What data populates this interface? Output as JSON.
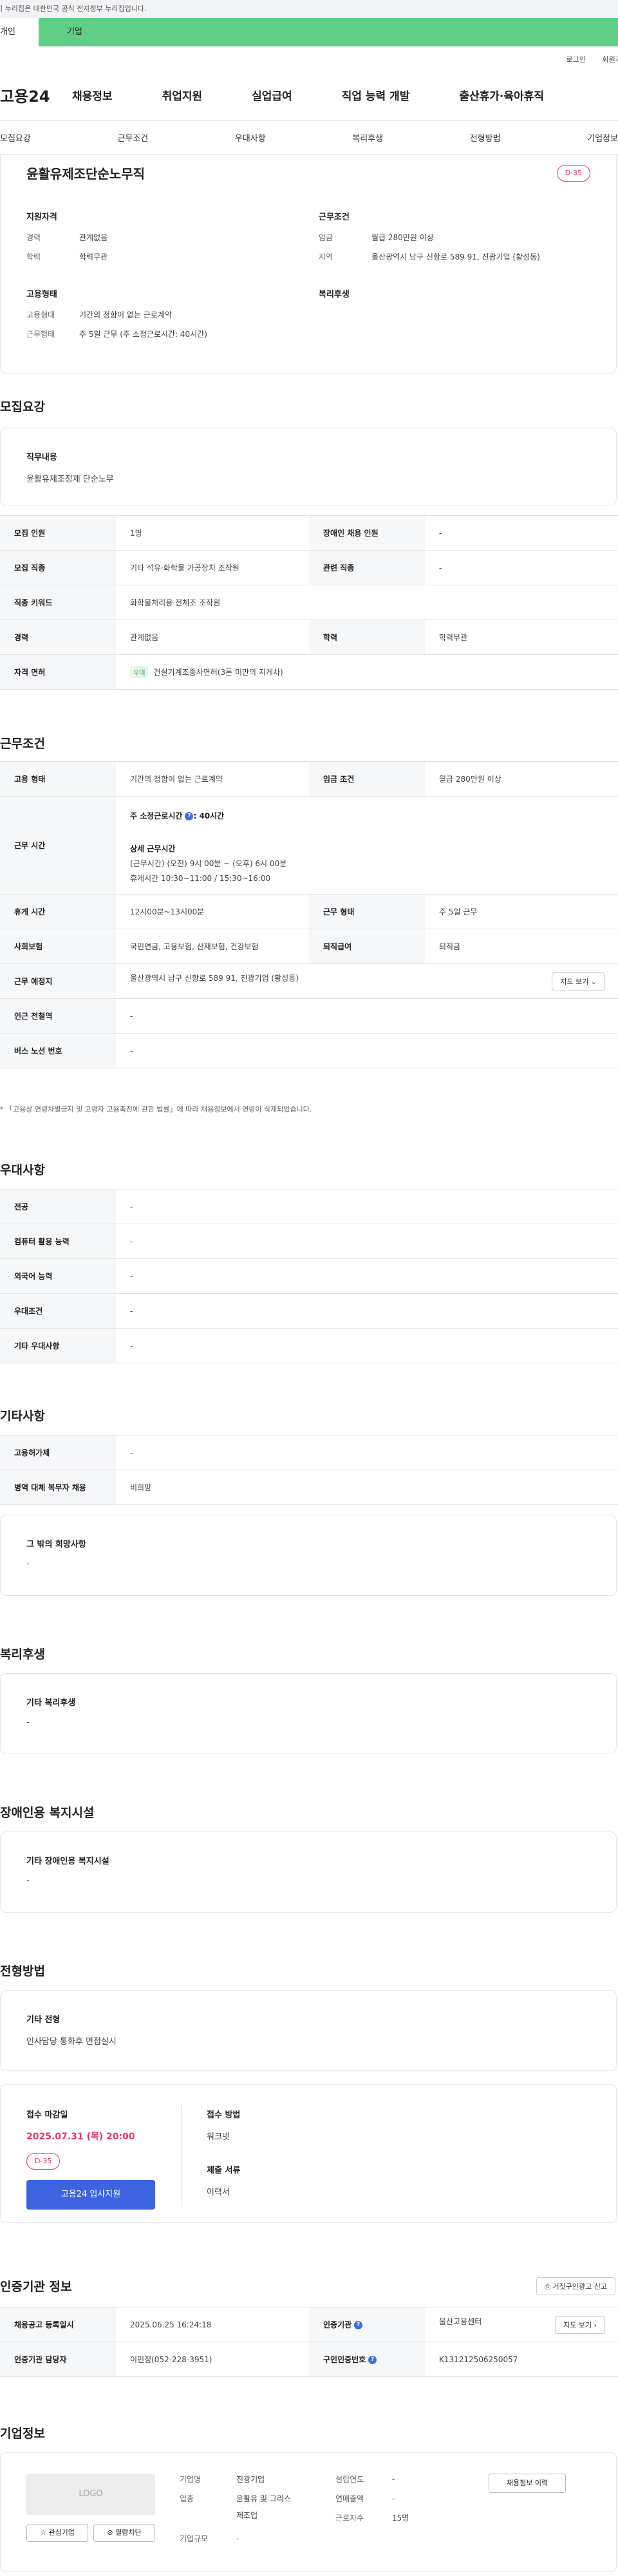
{
  "gov_banner": "이 누리집은 대한민국 공식 전자정부 누리집입니다.",
  "user_tabs": [
    "개인",
    "기업"
  ],
  "util_links": [
    "로그인",
    "회원가입"
  ],
  "site_logo": "고용24",
  "gnb": [
    "채용정보",
    "취업지원",
    "실업급여",
    "직업 능력 개발",
    "출산휴가·육아휴직"
  ],
  "subnav": [
    "모집요강",
    "근무조건",
    "우대사항",
    "복리후생",
    "전형방법",
    "기업정보"
  ],
  "summary": {
    "title": "윤활유제조단순노무직",
    "dday": "D-35",
    "qual_title": "지원자격",
    "qual": [
      {
        "k": "경력",
        "v": "관계없음"
      },
      {
        "k": "학력",
        "v": "학력무관"
      }
    ],
    "cond_title": "근무조건",
    "cond": [
      {
        "k": "임금",
        "v": "월급 280만원 이상"
      },
      {
        "k": "지역",
        "v": "울산광역시 남구 신항로 589 91, 진광기업 (황성동)"
      }
    ],
    "emp_title": "고용형태",
    "emp": [
      {
        "k": "고용형태",
        "v": "기간의 정함이 없는 근로계약"
      },
      {
        "k": "근무형태",
        "v": "주 5일 근무 (주 소정근로시간: 40시간)"
      }
    ],
    "welfare_title": "복리후생"
  },
  "recruit": {
    "heading": "모집요강",
    "job_title": "직무내용",
    "job_value": "윤활유제조정제 단순노무",
    "rows": [
      {
        "h1": "모집 인원",
        "v1": "1명",
        "h2": "장애인 채용 인원",
        "v2": "-"
      },
      {
        "h1": "모집 직종",
        "v1": "기타 석유·화학물 가공장치 조작원",
        "h2": "관련 직종",
        "v2": "-"
      },
      {
        "h1": "직종 키워드",
        "v1": "화학물처리용 전체조 조작원",
        "h2": "",
        "v2": ""
      },
      {
        "h1": "경력",
        "v1": "관계없음",
        "h2": "학력",
        "v2": "학력무관"
      },
      {
        "h1": "자격 면허",
        "v1": "건설기계조종사면허(3톤 미만의 지게차)",
        "h2": "",
        "v2": ""
      }
    ],
    "license_badge": "우대"
  },
  "conditions": {
    "heading": "근무조건",
    "r1": {
      "h1": "고용 형태",
      "v1": "기간의 정함이 없는 근로계약",
      "h2": "임금 조건",
      "v2": "월급 280만원 이상"
    },
    "work_time_h": "근무 시간",
    "work_time_main": "주 소정근로시간",
    "work_time_main_val": ": 40시간",
    "work_time_detail_title": "상세 근무시간",
    "work_time_detail_1": "(근무시간) (오전) 9시 00분 ~ (오후) 6시 00분",
    "work_time_detail_2": "휴게시간 10:30~11:00 / 15:30~16:00",
    "r3": {
      "h1": "휴게 시간",
      "v1": "12시00분~13시00분",
      "h2": "근무 형태",
      "v2": "주 5일 근무"
    },
    "r4": {
      "h1": "사회보험",
      "v1": "국민연금, 고용보험, 산재보험, 건강보험",
      "h2": "퇴직급여",
      "v2": "퇴직금"
    },
    "r5": {
      "h1": "근무 예정지",
      "v1": "울산광역시 남구 신항로 589 91, 진광기업 (황성동)",
      "btn": "지도 보기"
    },
    "r6": {
      "h1": "인근 전철역",
      "v1": "-"
    },
    "r7": {
      "h1": "버스 노선 번호",
      "v1": "-"
    },
    "note": "* 「고용상 연령차별금지 및 고령자 고용촉진에 관한 법률」에 따라 채용정보에서 연령이 삭제되었습니다."
  },
  "preferences": {
    "heading": "우대사항",
    "rows": [
      {
        "h": "전공",
        "v": "-"
      },
      {
        "h": "컴퓨터 활용 능력",
        "v": "-"
      },
      {
        "h": "외국어 능력",
        "v": "-"
      },
      {
        "h": "우대조건",
        "v": "-"
      },
      {
        "h": "기타 우대사항",
        "v": "-"
      }
    ]
  },
  "etc": {
    "heading": "기타사항",
    "rows": [
      {
        "h": "고용허가제",
        "v": "-"
      },
      {
        "h": "병역 대체 복무자 채용",
        "v": "비희망"
      }
    ],
    "other_title": "그 밖의 희망사항",
    "other_value": "-"
  },
  "welfare": {
    "heading": "복리후생",
    "title": "기타 복리후생",
    "value": "-"
  },
  "disabled": {
    "heading": "장애인용 복지시설",
    "title": "기타 장애인용 복지시설",
    "value": "-"
  },
  "selection": {
    "heading": "전형방법",
    "title": "기타 전형",
    "value": "인사담당 통화후 면접실시",
    "deadline_title": "접수 마감일",
    "deadline": "2025.07.31 (목) 20:00",
    "dday": "D-35",
    "apply_btn": "고용24 입사지원",
    "method_title": "접수 방법",
    "method": "워크넷",
    "docs_title": "제출 서류",
    "docs": "이력서"
  },
  "agency": {
    "heading": "인증기관 정보",
    "report_btn": "거짓구인광고 신고",
    "r1": {
      "h1": "채용공고 등록일시",
      "v1": "2025.06.25 16:24:18",
      "h2": "인증기관",
      "v2": "울산고용센터",
      "btn": "지도 보기"
    },
    "r2": {
      "h1": "인증기관 담당자",
      "v1": "이민정(052-228-3951)",
      "h2": "구인인증번호",
      "v2": "K131212506250057"
    }
  },
  "company": {
    "heading": "기업정보",
    "logo": "LOGO",
    "fav_btn": "관심기업",
    "block_btn": "열람차단",
    "name_k": "기업명",
    "name_v": "진광기업",
    "ind_k": "업종",
    "ind_v1": "윤활유 및 그리스",
    "ind_v2": "제조업",
    "size_k": "기업규모",
    "size_v": "-",
    "est_k": "설립연도",
    "est_v": "-",
    "sales_k": "연매출액",
    "sales_v": "-",
    "emp_k": "근로자수",
    "emp_v": "15명",
    "history_btn": "채용정보 이력"
  }
}
